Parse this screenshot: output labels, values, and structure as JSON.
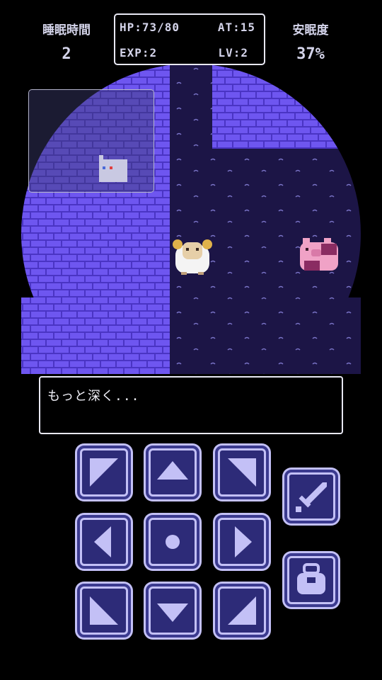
{
  "hud": {
    "sleep_time_label": "睡眠時間",
    "sleep_time_value": "2",
    "comfort_label": "安眠度",
    "comfort_value": "37%",
    "hp": "HP:73/80",
    "at": "AT:15",
    "exp": "EXP:2",
    "lv": "LV:2"
  },
  "message": {
    "text": "もっと深く..."
  },
  "colors": {
    "brick": "#6e56f0",
    "brick_mortar": "#4a34c4",
    "floor": "#1c1546",
    "button_face": "#c3c0f6",
    "button_inner": "#2d2b78"
  },
  "controls": {
    "dpad": [
      "up-left",
      "up",
      "up-right",
      "left",
      "wait",
      "right",
      "down-left",
      "down",
      "down-right"
    ],
    "action_buttons": [
      "sword-icon",
      "bag-icon"
    ]
  }
}
